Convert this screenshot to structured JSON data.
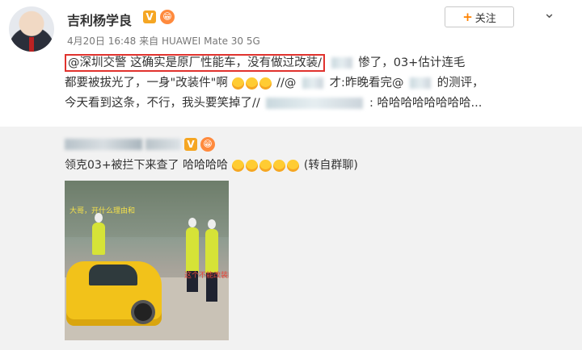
{
  "user": {
    "name": "吉利杨学良",
    "verified_mark": "V",
    "level_mark": "😁"
  },
  "meta": {
    "date": "4月20日",
    "time": "16:48",
    "source_prefix": "来自",
    "device": "HUAWEI Mate 30 5G"
  },
  "header": {
    "follow_label": "关注",
    "follow_plus": "+",
    "menu_icon": "chevron-down-icon"
  },
  "post": {
    "line1_highlight": "@深圳交警 这确实是原厂性能车，没有做过改装/",
    "line1_rest": "惨了，03+估计连毛",
    "line2_a": "都要被拔光了，一身\"改装件\"啊",
    "line2_b": "//@",
    "line2_c": "才:昨晚看完@",
    "line2_d": "的测评，",
    "line3_a": "今天看到这条，不行，我头要笑掉了//",
    "line3_b": ": 哈哈哈哈哈哈哈哈..."
  },
  "repost": {
    "text": "领克03+被拦下来查了 哈哈哈哈",
    "tail": "(转自群聊)",
    "media": {
      "caption1": "大哥，开什么理由和",
      "caption2": "这个不能改装的"
    }
  },
  "colors": {
    "highlight_border": "#e0322d",
    "follow_plus": "#ff8200",
    "verified": "#f5a623"
  }
}
